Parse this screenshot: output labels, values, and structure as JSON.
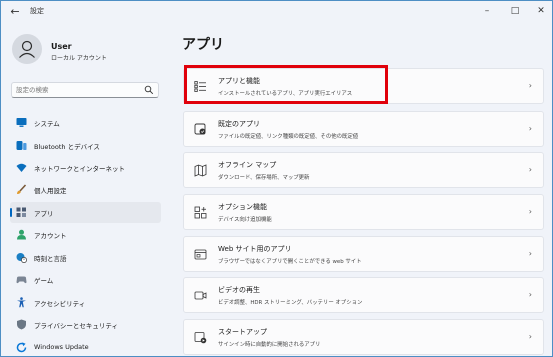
{
  "window": {
    "title": "設定",
    "back_glyph": "←",
    "min_glyph": "–",
    "max_glyph": "□",
    "close_glyph": "✕"
  },
  "user": {
    "name": "User",
    "account_type": "ローカル アカウント"
  },
  "search": {
    "placeholder": "設定の検索"
  },
  "nav": {
    "items": [
      {
        "label": "システム",
        "icon": "monitor-icon",
        "color": "#0067c0"
      },
      {
        "label": "Bluetooth とデバイス",
        "icon": "bluetooth-icon",
        "color": "#0067c0"
      },
      {
        "label": "ネットワークとインターネット",
        "icon": "wifi-icon",
        "color": "#0a6ebd"
      },
      {
        "label": "個人用設定",
        "icon": "brush-icon",
        "color": "#e09a2c"
      },
      {
        "label": "アプリ",
        "icon": "apps-icon",
        "color": "#4a5a72",
        "active": true
      },
      {
        "label": "アカウント",
        "icon": "person-icon",
        "color": "#2fa36b"
      },
      {
        "label": "時刻と言語",
        "icon": "globe-clock-icon",
        "color": "#1a7fc4"
      },
      {
        "label": "ゲーム",
        "icon": "gamepad-icon",
        "color": "#7b8594"
      },
      {
        "label": "アクセシビリティ",
        "icon": "accessibility-icon",
        "color": "#1a5fb4"
      },
      {
        "label": "プライバシーとセキュリティ",
        "icon": "shield-icon",
        "color": "#6b7785"
      },
      {
        "label": "Windows Update",
        "icon": "update-icon",
        "color": "#0a78d7"
      }
    ]
  },
  "main": {
    "title": "アプリ",
    "cards": [
      {
        "title": "アプリと機能",
        "desc": "インストールされているアプリ、アプリ実行エイリアス",
        "icon": "apps-list-icon",
        "highlighted": true
      },
      {
        "title": "既定のアプリ",
        "desc": "ファイルの既定値、リンク種類の既定値、その他の既定値",
        "icon": "default-apps-icon"
      },
      {
        "title": "オフライン マップ",
        "desc": "ダウンロード、保存場所、マップ更新",
        "icon": "map-icon"
      },
      {
        "title": "オプション機能",
        "desc": "デバイス向け追加機能",
        "icon": "optional-features-icon"
      },
      {
        "title": "Web サイト用のアプリ",
        "desc": "ブラウザーではなくアプリで開くことができる web サイト",
        "icon": "web-apps-icon"
      },
      {
        "title": "ビデオの再生",
        "desc": "ビデオ調整、HDR ストリーミング、バッテリー オプション",
        "icon": "video-icon"
      },
      {
        "title": "スタートアップ",
        "desc": "サインイン時に自動的に開始されるアプリ",
        "icon": "startup-icon"
      }
    ],
    "chevron": "›"
  },
  "colors": {
    "accent": "#0067c0",
    "highlight": "#e0000b"
  }
}
